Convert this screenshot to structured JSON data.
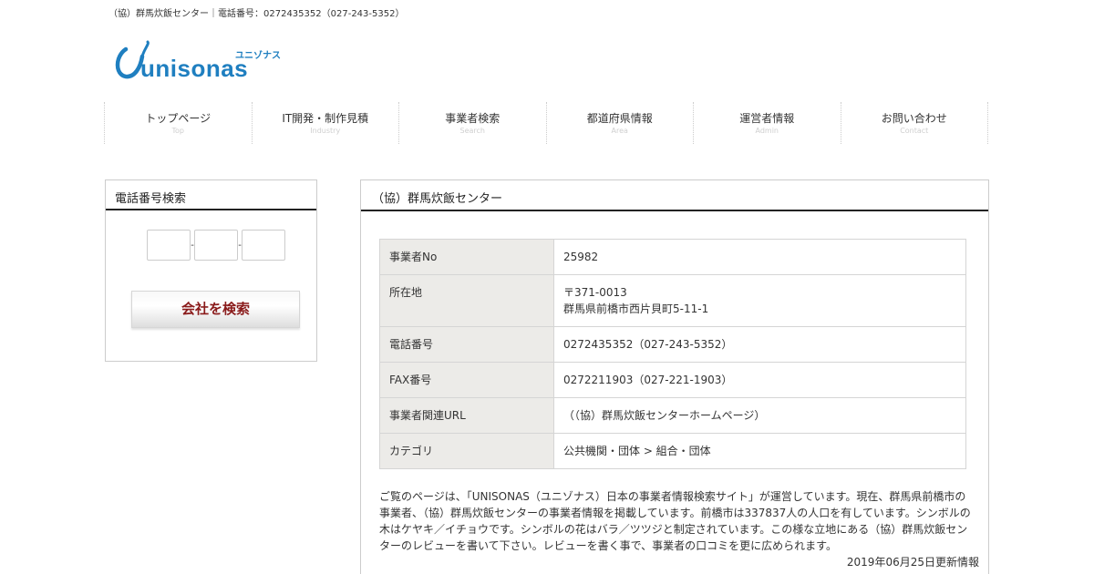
{
  "header": {
    "topline": "（協）群馬炊飯センター｜電話番号：0272435352（027-243-5352）",
    "logo_text": "unisonas",
    "logo_kana": "ユニゾナス"
  },
  "nav": [
    {
      "label": "トップページ",
      "sub": "Top"
    },
    {
      "label": "IT開発・制作見積",
      "sub": "Industry"
    },
    {
      "label": "事業者検索",
      "sub": "Search"
    },
    {
      "label": "都道府県情報",
      "sub": "Area"
    },
    {
      "label": "運営者情報",
      "sub": "Admin"
    },
    {
      "label": "お問い合わせ",
      "sub": "Contact"
    }
  ],
  "sidebar": {
    "title": "電話番号検索",
    "dash": "-",
    "button": "会社を検索"
  },
  "main": {
    "title": "（協）群馬炊飯センター",
    "rows": [
      {
        "key": "事業者No",
        "value": "25982",
        "value2": ""
      },
      {
        "key": "所在地",
        "value": "〒371-0013",
        "value2": "群馬県前橋市西片貝町5-11-1"
      },
      {
        "key": "電話番号",
        "value": "0272435352（027-243-5352）",
        "value2": ""
      },
      {
        "key": "FAX番号",
        "value": "0272211903（027-221-1903）",
        "value2": ""
      },
      {
        "key": "事業者関連URL",
        "value": "（（協）群馬炊飯センターホームページ）",
        "value2": ""
      },
      {
        "key": "カテゴリ",
        "value": "公共機関・団体 > 組合・団体",
        "value2": ""
      }
    ],
    "description": "ご覧のページは、「UNISONAS（ユニゾナス）日本の事業者情報検索サイト」が運営しています。現在、群馬県前橋市の事業者、（協）群馬炊飯センターの事業者情報を掲載しています。前橋市は337837人の人口を有しています。シンボルの木はケヤキ／イチョウです。シンボルの花はバラ／ツツジと制定されています。この様な立地にある（協）群馬炊飯センターのレビューを書いて下さい。レビューを書く事で、事業者の口コミを更に広められます。",
    "updated": "2019年06月25日更新情報"
  },
  "colors": {
    "brand": "#1f7fc0",
    "button_text": "#8a1b1b",
    "table_key_bg": "#ecebe8"
  }
}
